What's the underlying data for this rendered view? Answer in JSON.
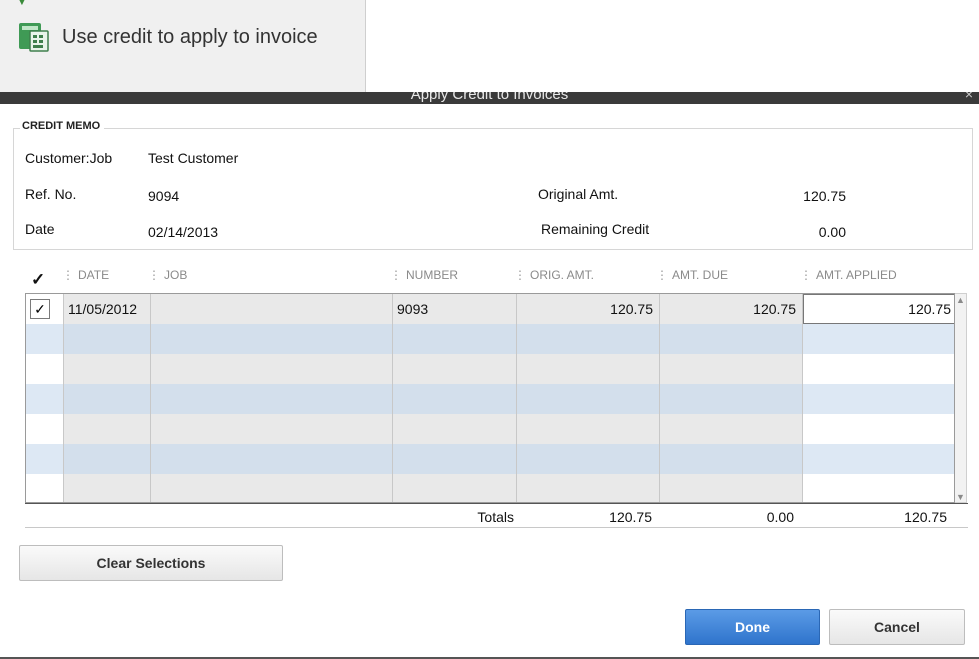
{
  "toolbar": {
    "button_label": "Use credit to apply to invoice"
  },
  "window": {
    "title": "Apply Credit to Invoices",
    "close_glyph": "×"
  },
  "credit_memo": {
    "legend": "CREDIT MEMO",
    "customer_job_label": "Customer:Job",
    "customer_job_value": "Test Customer",
    "ref_no_label": "Ref. No.",
    "ref_no_value": "9094",
    "date_label": "Date",
    "date_value": "02/14/2013",
    "original_amt_label": "Original Amt.",
    "original_amt_value": "120.75",
    "remaining_credit_label": "Remaining Credit",
    "remaining_credit_value": "0.00"
  },
  "table": {
    "check_header": "✓",
    "columns": [
      "DATE",
      "JOB",
      "NUMBER",
      "ORIG. AMT.",
      "AMT. DUE",
      "AMT. APPLIED"
    ],
    "rows": [
      {
        "checked": "✓",
        "date": "11/05/2012",
        "job": "",
        "number": "9093",
        "orig_amt": "120.75",
        "amt_due": "120.75",
        "amt_applied": "120.75"
      }
    ],
    "totals_label": "Totals",
    "totals_orig_amt": "120.75",
    "totals_amt_due": "0.00",
    "totals_amt_applied": "120.75"
  },
  "buttons": {
    "clear_selections": "Clear Selections",
    "done": "Done",
    "cancel": "Cancel"
  },
  "colors": {
    "row_band_blue": "#d3dfec",
    "row_band_white": "#ffffff",
    "primary_button": "#3a7fd5"
  }
}
